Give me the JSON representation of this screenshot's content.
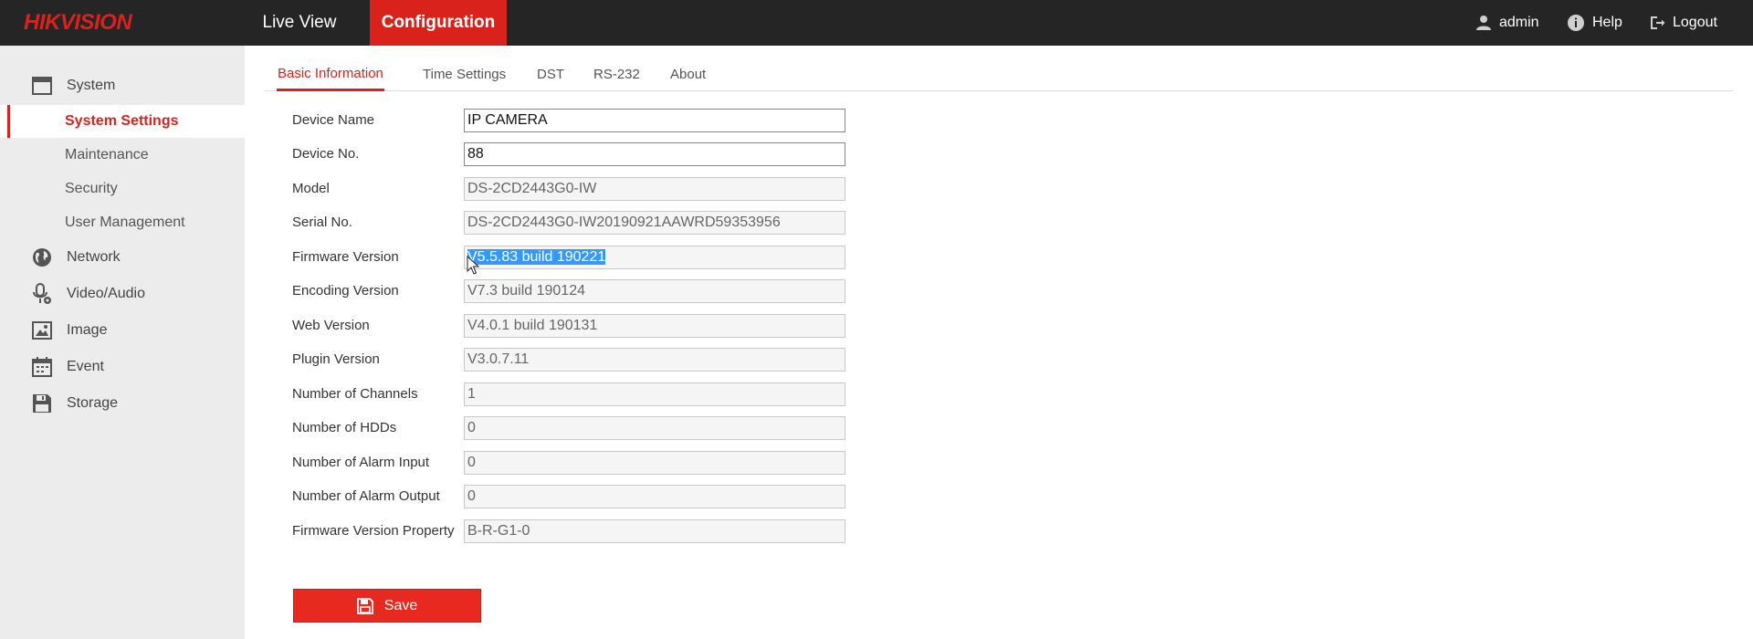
{
  "brand": {
    "logo_text": "HIKVISION",
    "accent_color": "#d9221c"
  },
  "header": {
    "nav": [
      {
        "label": "Live View",
        "active": false
      },
      {
        "label": "Configuration",
        "active": true
      }
    ],
    "user": {
      "label": "admin",
      "icon": "user-icon"
    },
    "help": {
      "label": "Help",
      "icon": "info-icon"
    },
    "logout": {
      "label": "Logout",
      "icon": "logout-icon"
    }
  },
  "sidebar": {
    "system": {
      "label": "System",
      "icon": "window-icon"
    },
    "system_items": [
      {
        "label": "System Settings",
        "active": true
      },
      {
        "label": "Maintenance",
        "active": false
      },
      {
        "label": "Security",
        "active": false
      },
      {
        "label": "User Management",
        "active": false
      }
    ],
    "sections": [
      {
        "label": "Network",
        "icon": "globe-icon"
      },
      {
        "label": "Video/Audio",
        "icon": "microphone-gear-icon"
      },
      {
        "label": "Image",
        "icon": "image-icon"
      },
      {
        "label": "Event",
        "icon": "calendar-icon"
      },
      {
        "label": "Storage",
        "icon": "floppy-icon"
      }
    ]
  },
  "tabs": [
    {
      "label": "Basic Information",
      "active": true
    },
    {
      "label": "Time Settings",
      "active": false
    },
    {
      "label": "DST",
      "active": false
    },
    {
      "label": "RS-232",
      "active": false
    },
    {
      "label": "About",
      "active": false
    }
  ],
  "form": {
    "fields": [
      {
        "label": "Device Name",
        "value": "IP CAMERA",
        "editable": true
      },
      {
        "label": "Device No.",
        "value": "88",
        "editable": true
      },
      {
        "label": "Model",
        "value": "DS-2CD2443G0-IW",
        "editable": false
      },
      {
        "label": "Serial No.",
        "value": "DS-2CD2443G0-IW20190921AAWRD59353956",
        "editable": false
      },
      {
        "label": "Firmware Version",
        "value": "V5.5.83 build 190221",
        "editable": false,
        "selected": true
      },
      {
        "label": "Encoding Version",
        "value": "V7.3 build 190124",
        "editable": false
      },
      {
        "label": "Web Version",
        "value": "V4.0.1 build 190131",
        "editable": false
      },
      {
        "label": "Plugin Version",
        "value": "V3.0.7.11",
        "editable": false
      },
      {
        "label": "Number of Channels",
        "value": "1",
        "editable": false
      },
      {
        "label": "Number of HDDs",
        "value": "0",
        "editable": false
      },
      {
        "label": "Number of Alarm Input",
        "value": "0",
        "editable": false
      },
      {
        "label": "Number of Alarm Output",
        "value": "0",
        "editable": false
      },
      {
        "label": "Firmware Version Property",
        "value": "B-R-G1-0",
        "editable": false
      }
    ],
    "save_label": "Save"
  }
}
